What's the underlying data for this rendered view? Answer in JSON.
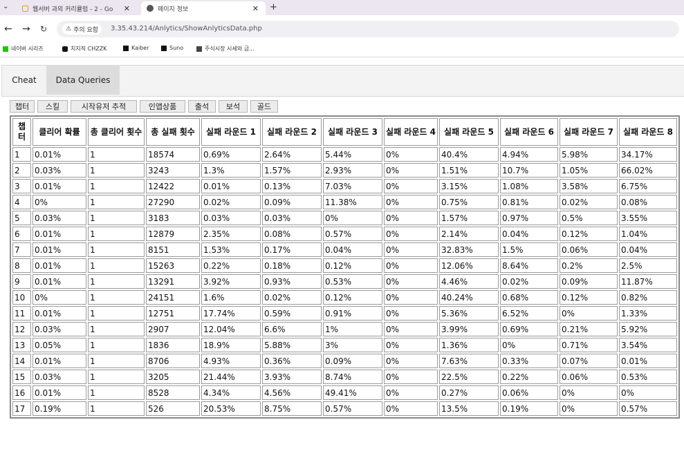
{
  "browser": {
    "tabs": [
      {
        "title": "웹서버 과외 커리큘럼 - 2 - Go"
      },
      {
        "title": "페이지 정보"
      }
    ],
    "security_label": "주의 요함",
    "url": "3.35.43.214/Anlytics/ShowAnlyticsData.php",
    "bookmarks": [
      "네이버 시리즈",
      "치지직 CHZZK",
      "Kaiber",
      "Suno",
      "주식시장 시세와 금..."
    ]
  },
  "page": {
    "tabs": [
      "Cheat",
      "Data Queries"
    ],
    "buttons": [
      "챕터",
      "스킬",
      "시작유저 추적",
      "인앱상품",
      "출석",
      "보석",
      "골드"
    ],
    "headers": [
      "챕터",
      "클리어 확률",
      "총 클리어 횟수",
      "총 실패 횟수",
      "실패 라운드 1",
      "실패 라운드 2",
      "실패 라운드 3",
      "실패 라운드 4",
      "실패 라운드 5",
      "실패 라운드 6",
      "실패 라운드 7",
      "실패 라운드 8"
    ],
    "rows": [
      [
        "1",
        "0.01%",
        "1",
        "18574",
        "0.69%",
        "2.64%",
        "5.44%",
        "0%",
        "40.4%",
        "4.94%",
        "5.98%",
        "34.17%"
      ],
      [
        "2",
        "0.03%",
        "1",
        "3243",
        "1.3%",
        "1.57%",
        "2.93%",
        "0%",
        "1.51%",
        "10.7%",
        "1.05%",
        "66.02%"
      ],
      [
        "3",
        "0.01%",
        "1",
        "12422",
        "0.01%",
        "0.13%",
        "7.03%",
        "0%",
        "3.15%",
        "1.08%",
        "3.58%",
        "6.75%"
      ],
      [
        "4",
        "0%",
        "1",
        "27290",
        "0.02%",
        "0.09%",
        "11.38%",
        "0%",
        "0.75%",
        "0.81%",
        "0.02%",
        "0.08%"
      ],
      [
        "5",
        "0.03%",
        "1",
        "3183",
        "0.03%",
        "0.03%",
        "0%",
        "0%",
        "1.57%",
        "0.97%",
        "0.5%",
        "3.55%"
      ],
      [
        "6",
        "0.01%",
        "1",
        "12879",
        "2.35%",
        "0.08%",
        "0.57%",
        "0%",
        "2.14%",
        "0.04%",
        "0.12%",
        "1.04%"
      ],
      [
        "7",
        "0.01%",
        "1",
        "8151",
        "1.53%",
        "0.17%",
        "0.04%",
        "0%",
        "32.83%",
        "1.5%",
        "0.06%",
        "0.04%"
      ],
      [
        "8",
        "0.01%",
        "1",
        "15263",
        "0.22%",
        "0.18%",
        "0.12%",
        "0%",
        "12.06%",
        "8.64%",
        "0.2%",
        "2.5%"
      ],
      [
        "9",
        "0.01%",
        "1",
        "13291",
        "3.92%",
        "0.93%",
        "0.53%",
        "0%",
        "4.46%",
        "0.02%",
        "0.09%",
        "11.87%"
      ],
      [
        "10",
        "0%",
        "1",
        "24151",
        "1.6%",
        "0.02%",
        "0.12%",
        "0%",
        "40.24%",
        "0.68%",
        "0.12%",
        "0.82%"
      ],
      [
        "11",
        "0.01%",
        "1",
        "12751",
        "17.74%",
        "0.59%",
        "0.91%",
        "0%",
        "5.36%",
        "6.52%",
        "0%",
        "1.33%"
      ],
      [
        "12",
        "0.03%",
        "1",
        "2907",
        "12.04%",
        "6.6%",
        "1%",
        "0%",
        "3.99%",
        "0.69%",
        "0.21%",
        "5.92%"
      ],
      [
        "13",
        "0.05%",
        "1",
        "1836",
        "18.9%",
        "5.88%",
        "3%",
        "0%",
        "1.36%",
        "0%",
        "0.71%",
        "3.54%"
      ],
      [
        "14",
        "0.01%",
        "1",
        "8706",
        "4.93%",
        "0.36%",
        "0.09%",
        "0%",
        "7.63%",
        "0.33%",
        "0.07%",
        "0.01%"
      ],
      [
        "15",
        "0.03%",
        "1",
        "3205",
        "21.44%",
        "3.93%",
        "8.74%",
        "0%",
        "22.5%",
        "0.22%",
        "0.06%",
        "0.53%"
      ],
      [
        "16",
        "0.01%",
        "1",
        "8528",
        "4.34%",
        "4.56%",
        "49.41%",
        "0%",
        "0.27%",
        "0.06%",
        "0%",
        "0%"
      ],
      [
        "17",
        "0.19%",
        "1",
        "526",
        "20.53%",
        "8.75%",
        "0.57%",
        "0%",
        "13.5%",
        "0.19%",
        "0%",
        "0.57%"
      ]
    ]
  },
  "colors": {
    "tabbar": "#ebe6f0",
    "active_tab": "#dcdcdc"
  }
}
